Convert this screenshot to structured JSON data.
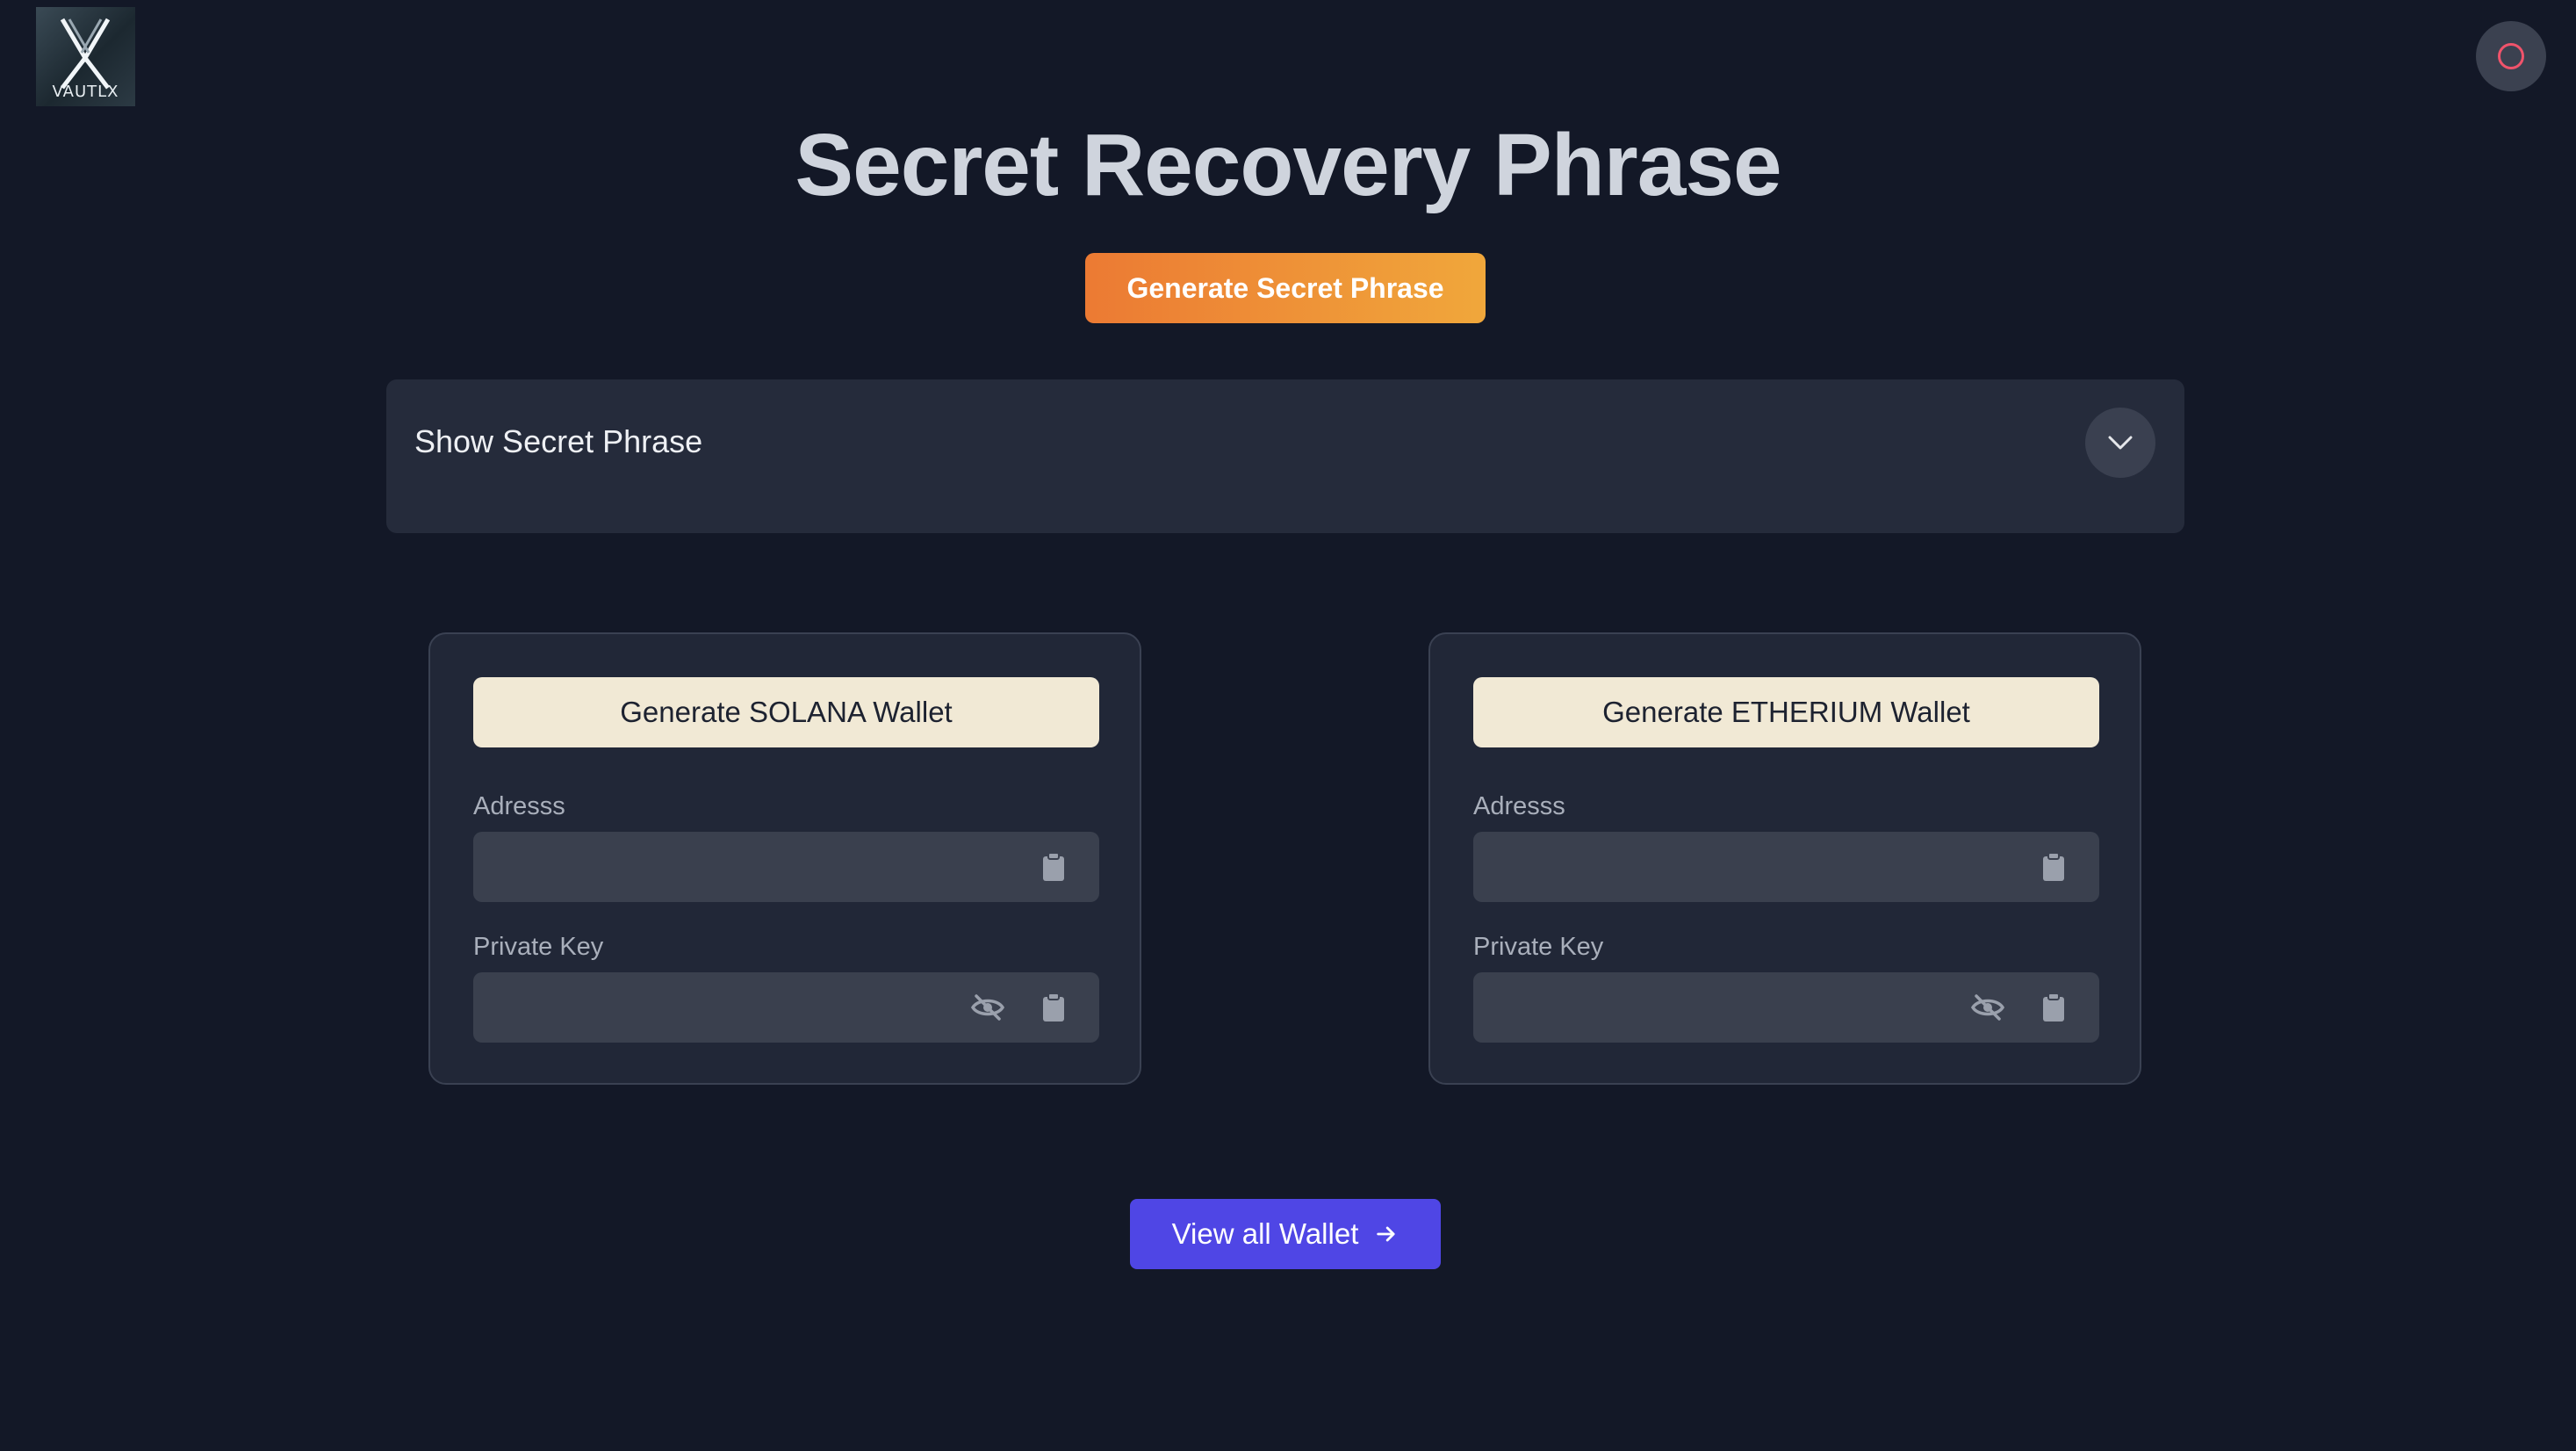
{
  "header": {
    "logo_text": "VAUTLX",
    "theme_toggle_icon": "circle-icon",
    "theme_toggle_color": "#f0536b"
  },
  "main": {
    "title": "Secret Recovery Phrase",
    "generate_phrase_label": "Generate Secret Phrase",
    "accordion": {
      "label": "Show Secret Phrase",
      "toggle_icon": "chevron-down-icon"
    },
    "wallets": [
      {
        "generate_label": "Generate SOLANA Wallet",
        "address_label": "Adresss",
        "address_value": "",
        "private_key_label": "Private Key",
        "private_key_value": ""
      },
      {
        "generate_label": "Generate ETHERIUM Wallet",
        "address_label": "Adresss",
        "address_value": "",
        "private_key_label": "Private Key",
        "private_key_value": ""
      }
    ],
    "view_all_label": "View all Wallet",
    "view_all_icon": "arrow-right-icon"
  },
  "colors": {
    "background": "#131827",
    "accent_orange": "#ec7a33",
    "accent_indigo": "#4f46e5",
    "card_button": "#f1e9d5"
  }
}
